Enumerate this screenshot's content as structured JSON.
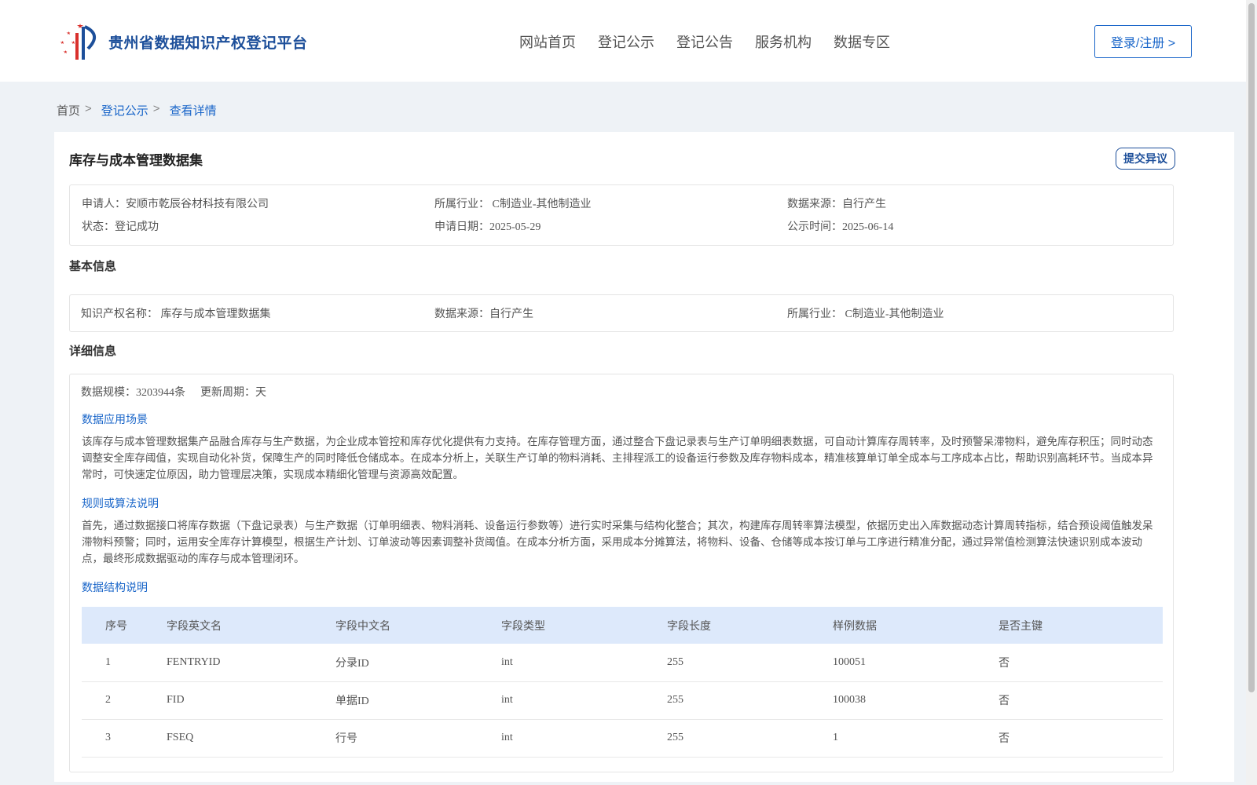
{
  "header": {
    "brand": "贵州省数据知识产权登记平台",
    "nav": [
      "网站首页",
      "登记公示",
      "登记公告",
      "服务机构",
      "数据专区"
    ],
    "login_label": "登录/注册 >"
  },
  "breadcrumb": {
    "home": "首页",
    "sep": ">",
    "items": [
      "登记公示",
      "查看详情"
    ]
  },
  "dataset": {
    "title": "库存与成本管理数据集",
    "objection_label": "提交异议",
    "summary": {
      "applicant": "申请人：安顺市乾辰谷材科技有限公司",
      "industry": "所属行业： C制造业-其他制造业",
      "source": "数据来源：自行产生",
      "status": "状态：登记成功",
      "apply_date": "申请日期：2025-05-29",
      "publish_date": "公示时间：2025-06-14"
    }
  },
  "basic": {
    "section_title": "基本信息",
    "ip_name": "知识产权名称： 库存与成本管理数据集",
    "source": "数据来源：自行产生",
    "industry": "所属行业： C制造业-其他制造业"
  },
  "detail": {
    "section_title": "详细信息",
    "scale": "数据规模：3203944条",
    "cycle": "更新周期：天",
    "scene_title": "数据应用场景",
    "scene_text": "该库存与成本管理数据集产品融合库存与生产数据，为企业成本管控和库存优化提供有力支持。在库存管理方面，通过整合下盘记录表与生产订单明细表数据，可自动计算库存周转率，及时预警呆滞物料，避免库存积压；同时动态调整安全库存阈值，实现自动化补货，保障生产的同时降低仓储成本。在成本分析上，关联生产订单的物料消耗、主排程派工的设备运行参数及库存物料成本，精准核算单订单全成本与工序成本占比，帮助识别高耗环节。当成本异常时，可快速定位原因，助力管理层决策，实现成本精细化管理与资源高效配置。",
    "rule_title": "规则或算法说明",
    "rule_text": "首先，通过数据接口将库存数据（下盘记录表）与生产数据（订单明细表、物料消耗、设备运行参数等）进行实时采集与结构化整合；其次，构建库存周转率算法模型，依据历史出入库数据动态计算周转指标，结合预设阈值触发呆滞物料预警；同时，运用安全库存计算模型，根据生产计划、订单波动等因素调整补货阈值。在成本分析方面，采用成本分摊算法，将物料、设备、仓储等成本按订单与工序进行精准分配，通过异常值检测算法快速识别成本波动点，最终形成数据驱动的库存与成本管理闭环。",
    "struct_title": "数据结构说明",
    "table": {
      "headers": [
        "序号",
        "字段英文名",
        "字段中文名",
        "字段类型",
        "字段长度",
        "样例数据",
        "是否主键"
      ],
      "rows": [
        [
          "1",
          "FENTRYID",
          "分录ID",
          "int",
          "255",
          "100051",
          "否"
        ],
        [
          "2",
          "FID",
          "单据ID",
          "int",
          "255",
          "100038",
          "否"
        ],
        [
          "3",
          "FSEQ",
          "行号",
          "int",
          "255",
          "1",
          "否"
        ]
      ]
    }
  },
  "colors": {
    "brand_blue": "#1d4f9a",
    "link_blue": "#1a66c9",
    "table_head_bg": "#dde9fb",
    "page_bg": "#eef2f6"
  }
}
